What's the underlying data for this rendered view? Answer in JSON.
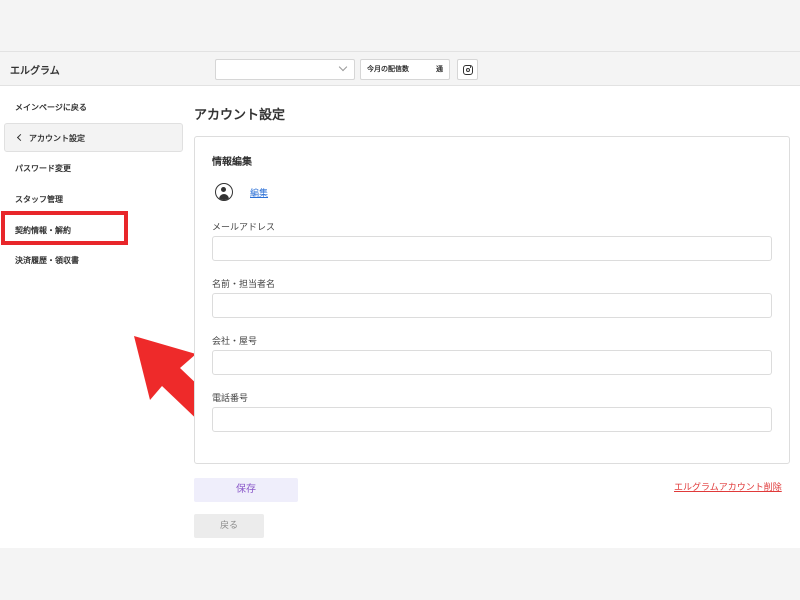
{
  "header": {
    "brand": "エルグラム",
    "account_select_value": "",
    "monthly_count_label": "今月の配信数",
    "monthly_count_value": "通",
    "instagram_icon": "instagram-icon"
  },
  "sidebar": {
    "items": [
      {
        "label": "メインページに戻る"
      },
      {
        "label": "アカウント設定",
        "active": true
      },
      {
        "label": "パスワード変更"
      },
      {
        "label": "スタッフ管理"
      },
      {
        "label": "契約情報・解約",
        "highlighted": true
      },
      {
        "label": "決済履歴・領収書"
      }
    ]
  },
  "main": {
    "title": "アカウント設定",
    "card": {
      "title": "情報編集",
      "avatar_icon": "user-avatar-icon",
      "edit_link": "編集",
      "fields": [
        {
          "label": "メールアドレス",
          "value": ""
        },
        {
          "label": "名前・担当者名",
          "value": ""
        },
        {
          "label": "会社・屋号",
          "value": ""
        },
        {
          "label": "電話番号",
          "value": ""
        }
      ]
    },
    "save_label": "保存",
    "back_label": "戻る",
    "delete_link": "エルグラムアカウント削除"
  },
  "annotation": {
    "highlight_color": "#e8262a",
    "arrow_color": "#ee2a2a"
  },
  "colors": {
    "accent_purple": "#8a58c9",
    "link_blue": "#2a6fd6",
    "danger_red": "#e03a3a"
  }
}
